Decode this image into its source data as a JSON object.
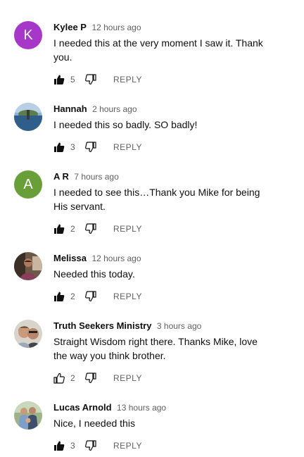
{
  "comments": [
    {
      "avatar_type": "letter",
      "letter": "K",
      "avatar_color": "#a737c8",
      "author": "Kylee P",
      "time": "12 hours ago",
      "text": "I needed this at the very moment I saw it. Thank you.",
      "likes": "5",
      "liked": true,
      "reply_label": "REPLY",
      "avatar_icon": "avatar"
    },
    {
      "avatar_type": "photo",
      "author": "Hannah",
      "time": "2 hours ago",
      "text": "I needed this so badly. SO badly!",
      "likes": "3",
      "liked": true,
      "reply_label": "REPLY",
      "avatar_icon": "landscape-photo-avatar"
    },
    {
      "avatar_type": "letter",
      "letter": "A",
      "avatar_color": "#689f38",
      "author": "A R",
      "time": "7 hours ago",
      "text": "I needed to see this…Thank you Mike for being His servant.",
      "likes": "2",
      "liked": true,
      "reply_label": "REPLY",
      "avatar_icon": "avatar"
    },
    {
      "avatar_type": "photo",
      "author": "Melissa",
      "time": "12 hours ago",
      "text": "Needed this today.",
      "likes": "2",
      "liked": true,
      "reply_label": "REPLY",
      "avatar_icon": "person-photo-avatar"
    },
    {
      "avatar_type": "photo",
      "author": "Truth Seekers Ministry",
      "time": "3 hours ago",
      "text": "Straight Wisdom right there. Thanks Mike, love the way you think brother.",
      "likes": "2",
      "liked": false,
      "reply_label": "REPLY",
      "avatar_icon": "couple-photo-avatar"
    },
    {
      "avatar_type": "photo",
      "author": "Lucas Arnold",
      "time": "13 hours ago",
      "text": "Nice, I needed this",
      "likes": "3",
      "liked": true,
      "reply_label": "REPLY",
      "avatar_icon": "family-photo-avatar"
    }
  ]
}
